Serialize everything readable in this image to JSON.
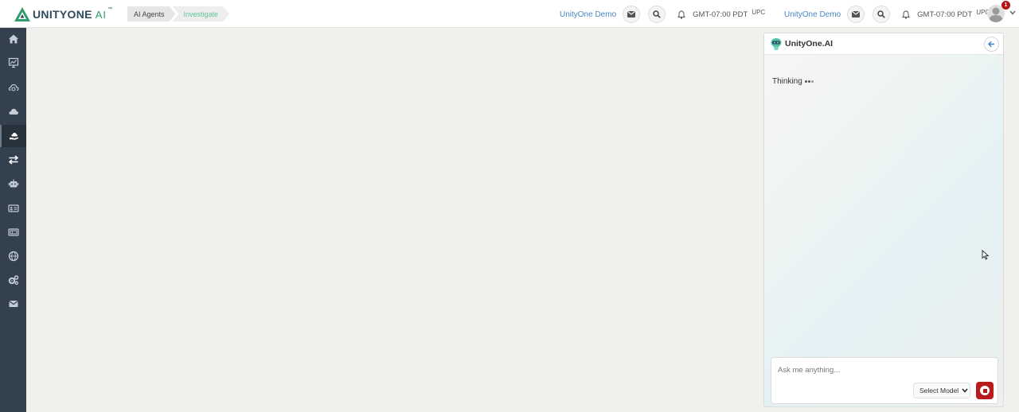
{
  "header": {
    "logo": {
      "brand": "UNITYONE",
      "suffix": "AI",
      "tm": "™"
    },
    "breadcrumbs": [
      "AI Agents",
      "Investigate"
    ],
    "groups": [
      {
        "account": "UnityOne Demo",
        "timezone": "GMT-07:00 PDT",
        "user_code": "UPC"
      },
      {
        "account": "UnityOne Demo",
        "timezone": "GMT-07:00 PDT",
        "user_code": "UPC"
      }
    ],
    "notification_count": "1"
  },
  "sidebar": {
    "items": [
      {
        "icon": "home-icon"
      },
      {
        "icon": "monitor-chart-icon"
      },
      {
        "icon": "cloud-sync-icon"
      },
      {
        "icon": "cloud-icon"
      },
      {
        "icon": "cloud-hand-icon",
        "active": true
      },
      {
        "icon": "transfer-arrows-icon"
      },
      {
        "icon": "robot-icon"
      },
      {
        "icon": "id-card-icon"
      },
      {
        "icon": "ticket-icon"
      },
      {
        "icon": "globe-icon"
      },
      {
        "icon": "gears-icon"
      },
      {
        "icon": "envelope-icon"
      }
    ]
  },
  "chat": {
    "title": "UnityOne.AI",
    "status": "Thinking",
    "input_placeholder": "Ask me anything...",
    "model_select": "Select Model"
  },
  "colors": {
    "sidebar_bg": "#33414e",
    "accent_green": "#2e9b6b",
    "link_blue": "#4a86c5",
    "stop_red": "#b71c1c"
  }
}
